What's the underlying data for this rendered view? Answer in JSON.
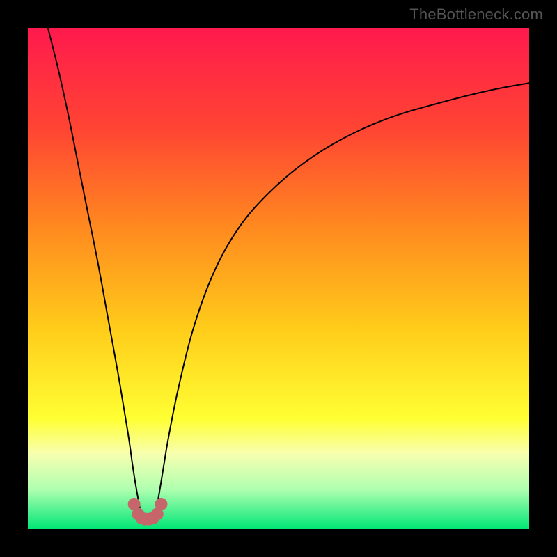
{
  "watermark": "TheBottleneck.com",
  "chart_data": {
    "type": "line",
    "title": "",
    "xlabel": "",
    "ylabel": "",
    "xlim": [
      0,
      100
    ],
    "ylim": [
      0,
      100
    ],
    "gradient_stops": [
      {
        "offset": 0.0,
        "color": "#ff1a4d"
      },
      {
        "offset": 0.2,
        "color": "#ff4433"
      },
      {
        "offset": 0.4,
        "color": "#ff8a1f"
      },
      {
        "offset": 0.6,
        "color": "#ffcc1a"
      },
      {
        "offset": 0.78,
        "color": "#ffff33"
      },
      {
        "offset": 0.85,
        "color": "#f7ffb0"
      },
      {
        "offset": 0.92,
        "color": "#b0ffb0"
      },
      {
        "offset": 1.0,
        "color": "#00e676"
      }
    ],
    "series": [
      {
        "name": "left-branch",
        "color": "#000000",
        "width": 2,
        "x": [
          4,
          6,
          8,
          10,
          12,
          14,
          16,
          18,
          20,
          21,
          22,
          22.7
        ],
        "y": [
          100,
          92,
          83,
          73,
          63,
          53,
          42,
          31,
          19,
          12,
          6,
          2.5
        ]
      },
      {
        "name": "right-branch",
        "color": "#000000",
        "width": 2,
        "x": [
          25.3,
          26,
          27,
          28,
          30,
          33,
          37,
          42,
          48,
          55,
          63,
          72,
          82,
          92,
          100
        ],
        "y": [
          2.5,
          6,
          12,
          18,
          28,
          40,
          51,
          60,
          67,
          73,
          78,
          82,
          85,
          87.5,
          89
        ]
      },
      {
        "name": "trough-markers",
        "type": "scatter",
        "color": "#c6666b",
        "size": 9,
        "x": [
          21.2,
          22.0,
          22.7,
          23.4,
          24.2,
          25.0,
          25.8,
          26.6
        ],
        "y": [
          5.0,
          3.0,
          2.2,
          2.0,
          2.0,
          2.2,
          3.0,
          5.0
        ]
      }
    ]
  }
}
